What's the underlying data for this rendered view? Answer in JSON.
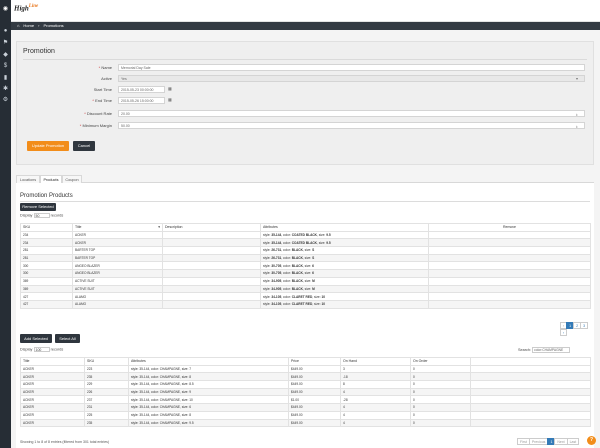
{
  "app": {
    "logo_text": "High",
    "logo_accent": "Line"
  },
  "sidebar": {
    "icons": [
      "dashboard-icon",
      "user-icon",
      "tag-icon",
      "dollar-icon",
      "chart-icon",
      "gear-icon"
    ]
  },
  "breadcrumb": {
    "home_label": "Home",
    "separator": "›",
    "current": "Promotions"
  },
  "promotion_form": {
    "title": "Promotion",
    "name_label": "Name",
    "name_value": "Memorial Day Sale",
    "active_label": "Active",
    "active_value": "Yes",
    "start_label": "Start Time",
    "start_value": "2015-05-23 00:00:00",
    "end_label": "End Time",
    "end_value": "2015-05-26 15:00:00",
    "discount_label": "Discount Rate",
    "discount_value": "20.00",
    "margin_label": "Minimum Margin",
    "margin_value": "50.00",
    "update_button": "Update Promotion",
    "cancel_button": "Cancel"
  },
  "tabs": [
    "Locations",
    "Products",
    "Coupon"
  ],
  "products_panel": {
    "title": "Promotion Products",
    "remove_button": "Remove Selected",
    "display_label": "Display",
    "display_value": "50",
    "records_label": "records",
    "columns": [
      "SKU",
      "Title",
      "Description",
      "Attributes",
      "Remove"
    ],
    "rows": [
      {
        "sku": "234",
        "title": "ACKER",
        "attr_prefix": "style: ",
        "attr_bold": "35-144",
        "attr_mid": ", color: ",
        "color": "COATED BLACK",
        "size": "9.5"
      },
      {
        "sku": "234",
        "title": "ACKER",
        "attr_prefix": "style: ",
        "attr_bold": "35-144",
        "attr_mid": ", color: ",
        "color": "COATED BLACK",
        "size": "9.5"
      },
      {
        "sku": "281",
        "title": "BARTER TOP",
        "attr_prefix": "style: ",
        "attr_bold": "26-731",
        "attr_mid": ", color: ",
        "color": "BLACK",
        "size": "S"
      },
      {
        "sku": "281",
        "title": "BARTER TOP",
        "attr_prefix": "style: ",
        "attr_bold": "26-731",
        "attr_mid": ", color: ",
        "color": "BLACK",
        "size": "S"
      },
      {
        "sku": "300",
        "title": "ANGEO BLAZER",
        "attr_prefix": "style: ",
        "attr_bold": "30-705",
        "attr_mid": ", color: ",
        "color": "BLACK",
        "size": "6"
      },
      {
        "sku": "300",
        "title": "ANGEO BLAZER",
        "attr_prefix": "style: ",
        "attr_bold": "30-705",
        "attr_mid": ", color: ",
        "color": "BLACK",
        "size": "6"
      },
      {
        "sku": "369",
        "title": "ACTIVE SUIT",
        "attr_prefix": "style: ",
        "attr_bold": "34-905",
        "attr_mid": ", color: ",
        "color": "BLACK",
        "size": "M"
      },
      {
        "sku": "369",
        "title": "ACTIVE SUIT",
        "attr_prefix": "style: ",
        "attr_bold": "34-905",
        "attr_mid": ", color: ",
        "color": "BLACK",
        "size": "M"
      },
      {
        "sku": "427",
        "title": "ALAMO",
        "attr_prefix": "style: ",
        "attr_bold": "34-105",
        "attr_mid": ", color: ",
        "color": "CLARET RED",
        "size": "10"
      },
      {
        "sku": "427",
        "title": "ALAMO",
        "attr_prefix": "style: ",
        "attr_bold": "34-105",
        "attr_mid": ", color: ",
        "color": "CLARET RED",
        "size": "10"
      }
    ],
    "pager": [
      "‹",
      "1",
      "2",
      "3",
      "›"
    ]
  },
  "available_panel": {
    "add_button": "Add Selected",
    "select_all_button": "Select All",
    "display_label": "Display",
    "display_value": "100",
    "records_label": "records",
    "search_label": "Search:",
    "search_value": "color:CHAMPAGNE",
    "columns": [
      "Title",
      "SKU",
      "Attributes",
      "Price",
      "On Hand",
      "On Order",
      ""
    ],
    "rows": [
      {
        "title": "ACKER",
        "sku": "223",
        "attrs": "style: 35-144, color: CHAMPAGNE, size: 7",
        "price": "$449.00",
        "on_hand": "3",
        "on_order": "0"
      },
      {
        "title": "ACKER",
        "sku": "235",
        "attrs": "style: 35-144, color: CHAMPAGNE, size: 8",
        "price": "$449.00",
        "on_hand": "-18",
        "on_order": "0"
      },
      {
        "title": "ACKER",
        "sku": "229",
        "attrs": "style: 35-144, color: CHAMPAGNE, size: 8.5",
        "price": "$449.00",
        "on_hand": "8",
        "on_order": "0"
      },
      {
        "title": "ACKER",
        "sku": "226",
        "attrs": "style: 35-144, color: CHAMPAGNE, size: 9",
        "price": "$449.00",
        "on_hand": "4",
        "on_order": "0"
      },
      {
        "title": "ACKER",
        "sku": "237",
        "attrs": "style: 35-144, color: CHAMPAGNE, size: 10",
        "price": "$1.00",
        "on_hand": "-28",
        "on_order": "0"
      },
      {
        "title": "ACKER",
        "sku": "231",
        "attrs": "style: 35-144, color: CHAMPAGNE, size: 6",
        "price": "$449.00",
        "on_hand": "4",
        "on_order": "0"
      },
      {
        "title": "ACKER",
        "sku": "225",
        "attrs": "style: 35-144, color: CHAMPAGNE, size: 8",
        "price": "$449.00",
        "on_hand": "4",
        "on_order": "0"
      },
      {
        "title": "ACKER",
        "sku": "235",
        "attrs": "style: 35-144, color: CHAMPAGNE, size: 9.5",
        "price": "$449.00",
        "on_hand": "4",
        "on_order": "0"
      }
    ],
    "info": "Showing 1 to 8 of 8 entries (filtered from 301 total entries)",
    "pager": [
      "First",
      "Previous",
      "1",
      "Next",
      "Last"
    ]
  },
  "colors": {
    "accent": "#f28d1a",
    "sidebar": "#262d35",
    "breadcrumb_bar": "#333a42"
  }
}
